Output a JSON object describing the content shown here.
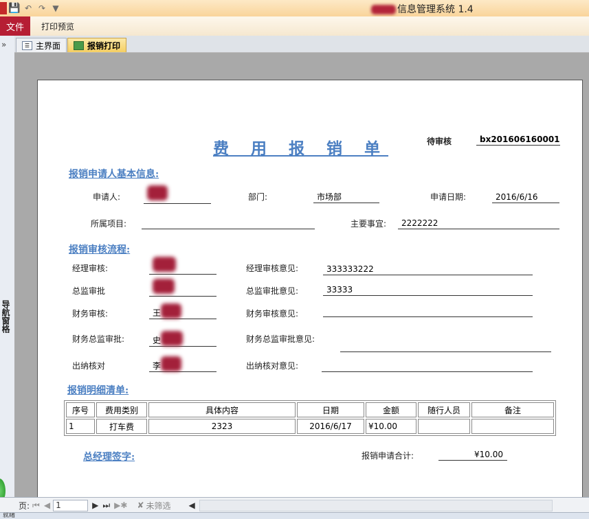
{
  "window": {
    "title": "信息管理系统 1.4"
  },
  "ribbon": {
    "file_tab": "文件",
    "tabs": [
      "打印预览"
    ]
  },
  "doc_tabs": [
    {
      "label": "主界面"
    },
    {
      "label": "报销打印"
    }
  ],
  "nav": {
    "chevron": "»",
    "vertical_text": "导航窗格"
  },
  "form": {
    "title": "费 用 报 销 单",
    "status": "待审核",
    "doc_no": "bx201606160001",
    "sections": {
      "basic": "报销申请人基本信息:",
      "approval": "报销审核流程:",
      "detail": "报销明细清单:"
    },
    "basic": {
      "applicant_label": "申请人:",
      "dept_label": "部门:",
      "dept_value": "市场部",
      "date_label": "申请日期:",
      "date_value": "2016/6/16",
      "project_label": "所属项目:",
      "project_value": "",
      "matter_label": "主要事宜:",
      "matter_value": "2222222"
    },
    "approval": [
      {
        "label": "经理审核:",
        "opinion_label": "经理审核意见:",
        "opinion": "333333222",
        "name_prefix": ""
      },
      {
        "label": "总监审批",
        "opinion_label": "总监审批意见:",
        "opinion": "33333",
        "name_prefix": ""
      },
      {
        "label": "财务审核:",
        "opinion_label": "财务审核意见:",
        "opinion": "",
        "name_prefix": "王"
      },
      {
        "label": "财务总监审批:",
        "opinion_label": "财务总监审批意见:",
        "opinion": "",
        "name_prefix": "史"
      },
      {
        "label": "出纳核对",
        "opinion_label": "出纳核对意见:",
        "opinion": "",
        "name_prefix": "李"
      }
    ],
    "detail_table": {
      "headers": [
        "序号",
        "费用类别",
        "具体内容",
        "日期",
        "金额",
        "随行人员",
        "备注"
      ],
      "rows": [
        [
          "1",
          "打车费",
          "2323",
          "2016/6/17",
          "¥10.00",
          "",
          ""
        ]
      ]
    },
    "footer": {
      "gm_sign": "总经理签字:",
      "total_label": "报销申请合计:",
      "total_value": "¥10.00"
    }
  },
  "record_nav": {
    "label": "页:",
    "current": "1",
    "filter": "未筛选"
  },
  "statusbar": {
    "text": "就绪"
  }
}
